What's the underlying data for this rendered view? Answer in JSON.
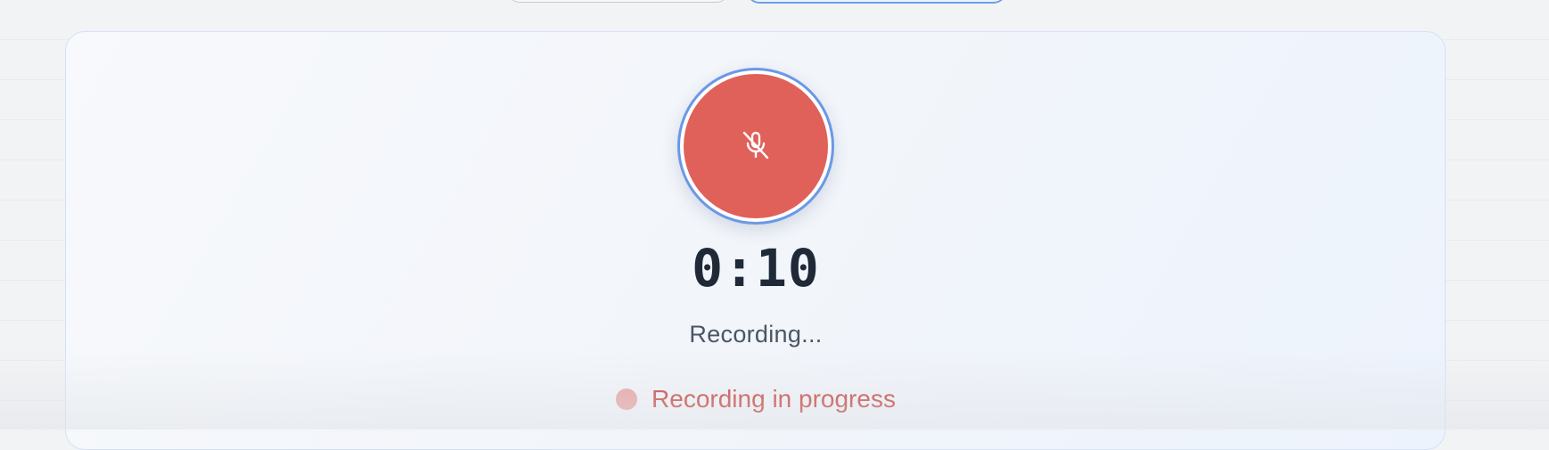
{
  "recorder": {
    "button_icon": "microphone-off-icon",
    "timer": "0:10",
    "status": "Recording...",
    "progress_label": "Recording in progress"
  },
  "colors": {
    "record_red": "#e0605a",
    "ring_blue": "#6b98e6",
    "status_red": "#c53a33",
    "dot_pink": "#e8a2a2"
  }
}
